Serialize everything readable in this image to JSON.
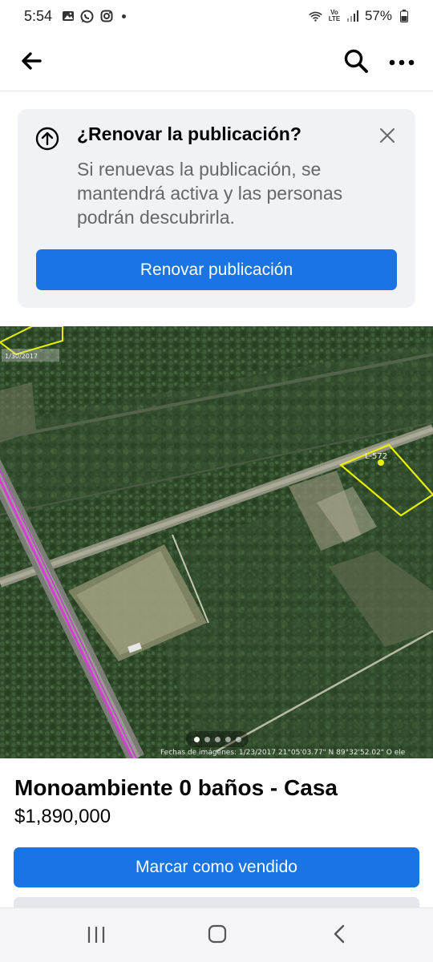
{
  "status_bar": {
    "time": "5:54",
    "battery": "57%",
    "network": "Vo LTE",
    "left_icons": [
      "gallery-icon",
      "whatsapp-icon",
      "instagram-icon",
      "notification-dot-icon"
    ],
    "right_icons": [
      "wifi-icon",
      "volte-icon",
      "signal-icon",
      "battery-icon"
    ]
  },
  "header": {
    "back_icon": "arrow-left-icon",
    "search_icon": "search-icon",
    "more_icon": "more-icon"
  },
  "renew_card": {
    "title": "¿Renovar la publicación?",
    "body": "Si renuevas la publicación, se mantendrá activa y las personas podrán descubrirla.",
    "button_label": "Renovar publicación",
    "icon": "upload-circle-icon",
    "close_icon": "close-icon"
  },
  "photo": {
    "pages": 5,
    "current_page": 1,
    "parcel_label": "L-572",
    "date_stamp": "1/30/2017",
    "imagery_credit": "Fechas de imágenes: 1/23/2017    21°05'03.77\" N    89°32'52.02\" O    ele"
  },
  "listing": {
    "title": "Monoambiente 0 baños - Casa",
    "price": "$1,890,000",
    "mark_sold_label": "Marcar como vendido"
  },
  "nav_bar": {
    "recents_icon": "recents-icon",
    "home_icon": "home-icon",
    "back_icon": "back-icon"
  },
  "colors": {
    "primary": "#1b74e4",
    "card_bg": "#f0f2f5",
    "secondary_text": "#65676b",
    "parcel_outline": "#e8f000",
    "road_line": "#d63cd6"
  }
}
